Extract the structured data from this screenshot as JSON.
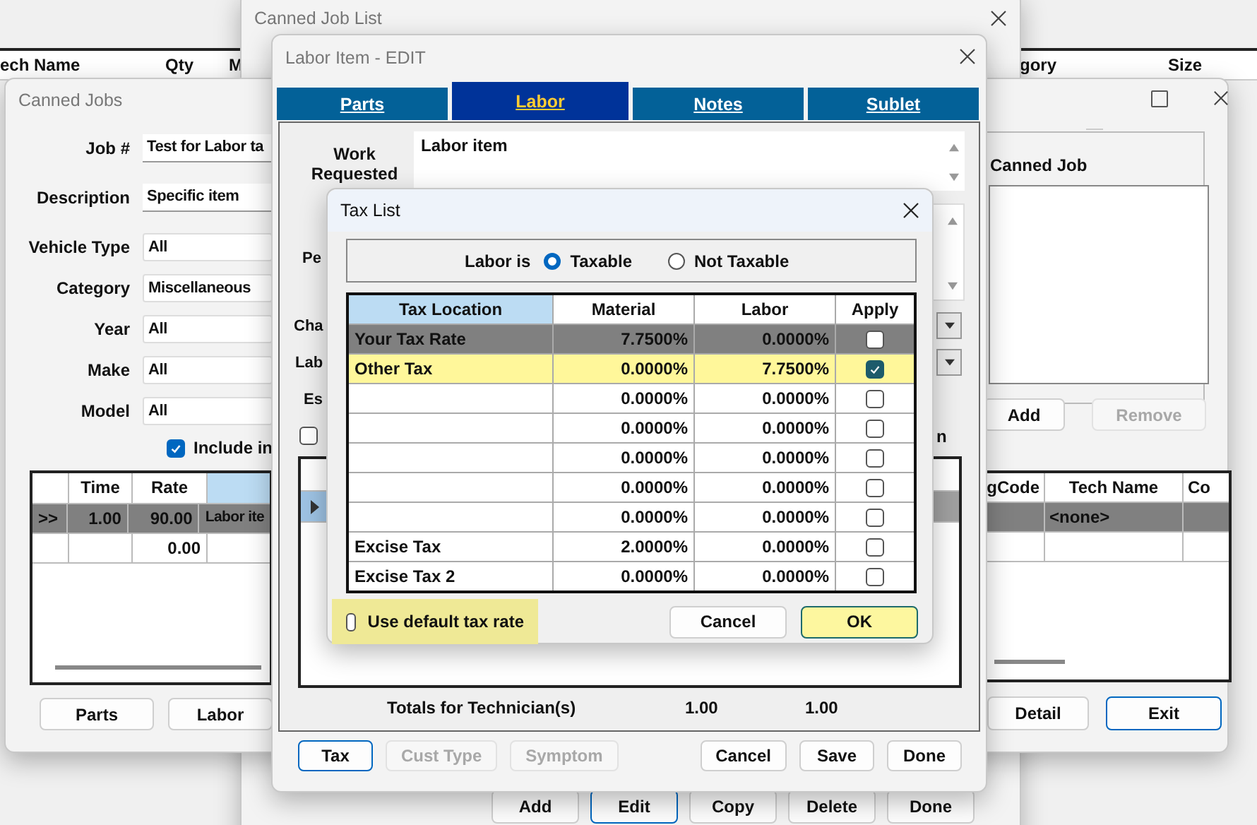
{
  "background_window": {
    "columns_left": [
      "ech Name",
      "Qty",
      "M"
    ],
    "columns_right": [
      "gory",
      "Size"
    ]
  },
  "canned_job_list": {
    "title": "Canned Job List",
    "buttons": [
      {
        "label": "Add",
        "focused": false
      },
      {
        "label": "Edit",
        "focused": true
      },
      {
        "label": "Copy",
        "focused": false
      },
      {
        "label": "Delete",
        "focused": false
      },
      {
        "label": "Done",
        "focused": false
      }
    ]
  },
  "canned_jobs": {
    "title": "Canned Jobs",
    "fields": [
      {
        "label": "Job #",
        "value": "Test for Labor ta",
        "kind": "text"
      },
      {
        "label": "Description",
        "value": "Specific item",
        "kind": "text"
      },
      {
        "label": "Vehicle Type",
        "value": "All",
        "kind": "dropdown"
      },
      {
        "label": "Category",
        "value": "Miscellaneous",
        "kind": "dropdown"
      },
      {
        "label": "Year",
        "value": "All",
        "kind": "dropdown"
      },
      {
        "label": "Make",
        "value": "All",
        "kind": "dropdown"
      },
      {
        "label": "Model",
        "value": "All",
        "kind": "dropdown"
      }
    ],
    "include_checkbox": {
      "label": "Include in",
      "checked": true
    },
    "labor_grid": {
      "columns": [
        "Time",
        "Rate"
      ],
      "rows": [
        {
          "marker": ">>",
          "time": "1.00",
          "rate": "90.00",
          "description": "Labor ite",
          "selected": true
        },
        {
          "rate": "0.00",
          "selected": false
        }
      ]
    },
    "left_buttons": [
      "Parts",
      "Labor"
    ],
    "canned_job_group": {
      "label": "Canned Job",
      "buttons": [
        {
          "label": "Add",
          "disabled": false
        },
        {
          "label": "Remove",
          "disabled": true
        }
      ]
    },
    "tech_grid": {
      "columns": [
        "gCode",
        "Tech Name",
        "Co"
      ],
      "rows": [
        {
          "tech_name": "<none>",
          "selected": true
        },
        {
          "selected": false
        }
      ]
    },
    "right_buttons": [
      {
        "label": "Detail",
        "focused": false
      },
      {
        "label": "Exit",
        "focused": true
      }
    ]
  },
  "labor_item": {
    "title": "Labor Item - EDIT",
    "tabs": [
      {
        "label": "Parts",
        "selected": false
      },
      {
        "label": "Labor",
        "selected": true
      },
      {
        "label": "Notes",
        "selected": false
      },
      {
        "label": "Sublet",
        "selected": false
      }
    ],
    "work_requested": {
      "label": "Work Requested",
      "value": "Labor item"
    },
    "fields": [
      {
        "label": "Pe",
        "kind": "memo"
      },
      {
        "label": "Cha",
        "kind": "dropdown"
      },
      {
        "label": "Lab",
        "kind": "dropdown"
      },
      {
        "label": "Es",
        "kind": "text"
      }
    ],
    "checkbox": {
      "checked": false
    },
    "label_fragment": "n",
    "grid": {
      "rows": [
        {
          "selected": true
        }
      ]
    },
    "totals": {
      "label": "Totals for Technician(s)",
      "values": [
        "1.00",
        "1.00"
      ]
    },
    "left_buttons": [
      {
        "label": "Tax",
        "disabled": false,
        "focused": true
      },
      {
        "label": "Cust Type",
        "disabled": true,
        "focused": false
      },
      {
        "label": "Symptom",
        "disabled": true,
        "focused": false
      }
    ],
    "right_buttons": [
      {
        "label": "Cancel",
        "disabled": false,
        "focused": false
      },
      {
        "label": "Save",
        "disabled": false,
        "focused": false
      },
      {
        "label": "Done",
        "disabled": false,
        "focused": false
      }
    ]
  },
  "tax_list": {
    "title": "Tax List",
    "labor_is": {
      "label": "Labor is",
      "options": [
        {
          "label": "Taxable",
          "selected": true
        },
        {
          "label": "Not Taxable",
          "selected": false
        }
      ]
    },
    "columns": [
      "Tax Location",
      "Material",
      "Labor",
      "Apply"
    ],
    "rows": [
      {
        "location": "Your Tax Rate",
        "material": "7.7500%",
        "labor": "0.0000%",
        "apply": false,
        "selected": true,
        "highlighted": false
      },
      {
        "location": "Other Tax",
        "material": "0.0000%",
        "labor": "7.7500%",
        "apply": true,
        "selected": false,
        "highlighted": true
      },
      {
        "material": "0.0000%",
        "labor": "0.0000%",
        "apply": false,
        "selected": false,
        "highlighted": false
      },
      {
        "material": "0.0000%",
        "labor": "0.0000%",
        "apply": false,
        "selected": false,
        "highlighted": false
      },
      {
        "material": "0.0000%",
        "labor": "0.0000%",
        "apply": false,
        "selected": false,
        "highlighted": false
      },
      {
        "material": "0.0000%",
        "labor": "0.0000%",
        "apply": false,
        "selected": false,
        "highlighted": false
      },
      {
        "material": "0.0000%",
        "labor": "0.0000%",
        "apply": false,
        "selected": false,
        "highlighted": false
      },
      {
        "location": "Excise Tax",
        "material": "2.0000%",
        "labor": "0.0000%",
        "apply": false,
        "selected": false,
        "highlighted": false
      },
      {
        "location": "Excise Tax 2",
        "material": "0.0000%",
        "labor": "0.0000%",
        "apply": false,
        "selected": false,
        "highlighted": false
      }
    ],
    "default_rate": {
      "label": "Use default tax rate",
      "checked": false
    },
    "buttons": [
      {
        "label": "Cancel",
        "default": false
      },
      {
        "label": "OK",
        "default": true
      }
    ]
  }
}
